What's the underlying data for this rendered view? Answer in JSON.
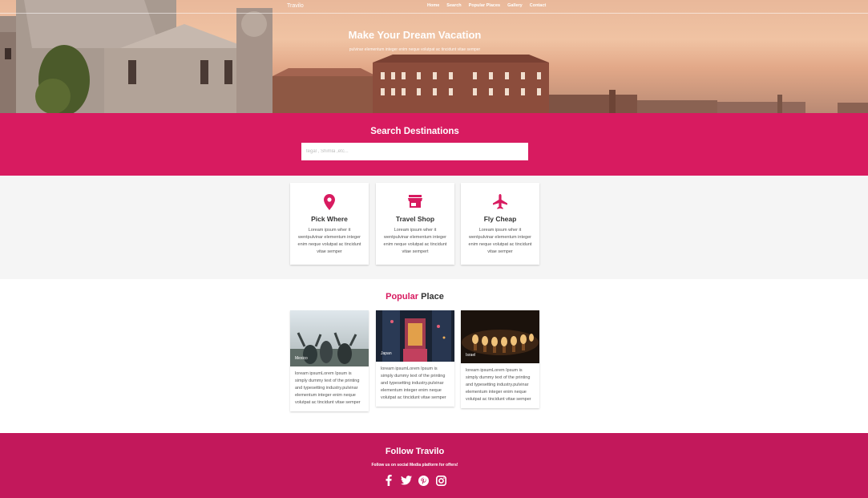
{
  "nav": {
    "brand": "Travilo",
    "links": [
      "Home",
      "Search",
      "Popular Places",
      "Gallery",
      "Contact"
    ]
  },
  "hero": {
    "title": "Make Your Dream Vacation",
    "subtitle": "pulvinar elementum integer enim neque volutpat ac tincidunt vitae semper"
  },
  "search": {
    "title": "Search Destinations",
    "placeholder": "tegal , Shimla ,etc..."
  },
  "features": [
    {
      "icon": "location-pin-icon",
      "title": "Pick Where",
      "text": "Loream ipsum wher it wentpulvinar elementum integer enim neque volutpat ac tincidunt vitae semper"
    },
    {
      "icon": "store-icon",
      "title": "Travel Shop",
      "text": "Loream ipsum wher it wentpulvinar elementum integer enim neque volutpat ac tincidunt vitae sempert"
    },
    {
      "icon": "airplane-icon",
      "title": "Fly Cheap",
      "text": "Loream ipsum wher it wentpulvinar elementum integer enim neque volutpat ac tincidunt vitae semper"
    }
  ],
  "popular": {
    "accent": "Popular",
    "rest": " Place",
    "places": [
      {
        "name": "Mexico",
        "text": "loream ipsumLorem Ipsum is simply dummy text of the printing and typesetting industry.pulvinar elementum integer enim neque volutpat ac tincidunt vitae semper"
      },
      {
        "name": "Japan",
        "text": "loream ipsumLorem Ipsum is simply dummy text of the printing and typesetting industry.pulvinar elementum integer enim neque volutpat ac tincidunt vitae semper"
      },
      {
        "name": "Israel",
        "text": "loream ipsumLorem Ipsum is simply dummy text of the printing and typesetting industry.pulvinar elementum integer enim neque volutpat ac tincidunt vitae semper"
      }
    ]
  },
  "footer": {
    "title": "Follow Travilo",
    "subtitle": "Follow us on social Media platform for offers!",
    "social": [
      "facebook-icon",
      "twitter-icon",
      "pinterest-icon",
      "instagram-icon"
    ]
  },
  "colors": {
    "accent": "#d81b60",
    "footer": "#c2185b",
    "features_bg": "#f5f5f5"
  }
}
